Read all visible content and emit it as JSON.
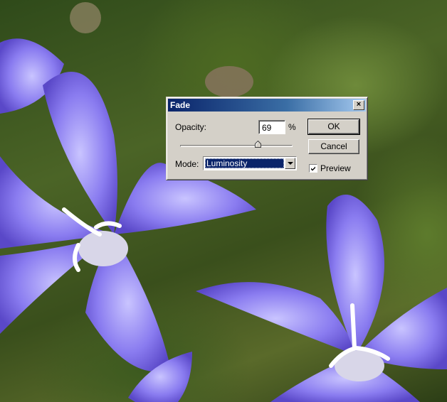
{
  "dialog": {
    "title": "Fade",
    "close_glyph": "×",
    "opacity": {
      "label": "Opacity:",
      "value": "69",
      "unit": "%",
      "slider_fraction": 0.69
    },
    "mode": {
      "label": "Mode:",
      "selected": "Luminosity"
    },
    "buttons": {
      "ok": "OK",
      "cancel": "Cancel"
    },
    "preview": {
      "label": "Preview",
      "checked": true
    }
  },
  "colors": {
    "dialog_face": "#d4d0c8",
    "titlebar_start": "#0a246a",
    "titlebar_end": "#a6caf0",
    "selection": "#0a246a"
  },
  "icons": {
    "close": "close-icon",
    "dropdown": "chevron-down-icon",
    "check": "check-icon",
    "slider_thumb": "slider-thumb-icon"
  }
}
